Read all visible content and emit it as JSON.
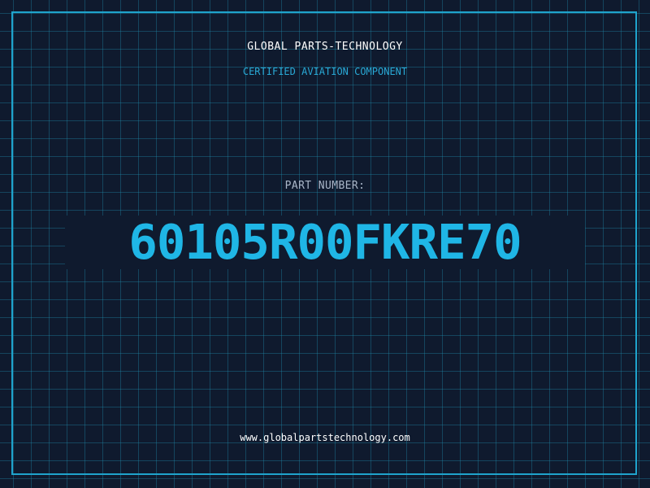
{
  "header": {
    "company": "GLOBAL PARTS-TECHNOLOGY",
    "subtitle": "CERTIFIED AVIATION COMPONENT"
  },
  "part": {
    "label": "PART NUMBER:",
    "number": "60105R00FKRE70"
  },
  "footer": {
    "url": "www.globalpartstechnology.com"
  },
  "colors": {
    "background": "#0f1a2e",
    "grid": "#208caa",
    "border": "#1fa3cc",
    "accent": "#1fb6e6",
    "label": "#a9b6c8",
    "text": "#ffffff"
  }
}
